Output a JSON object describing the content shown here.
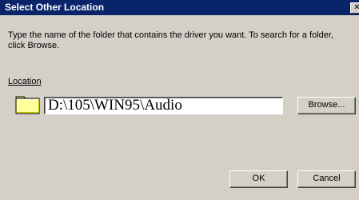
{
  "window": {
    "title": "Select Other Location",
    "close_glyph": "✕"
  },
  "description": "Type the name of the folder that contains the driver you want. To search for a folder, click Browse.",
  "location": {
    "label": "Location",
    "value": "D:\\105\\WIN95\\Audio",
    "icon": "folder-icon"
  },
  "buttons": {
    "browse": "Browse...",
    "ok": "OK",
    "cancel": "Cancel"
  },
  "colors": {
    "titlebar": "#0a246a",
    "dialog_face": "#d4d0c8",
    "folder": "#ffff99"
  }
}
